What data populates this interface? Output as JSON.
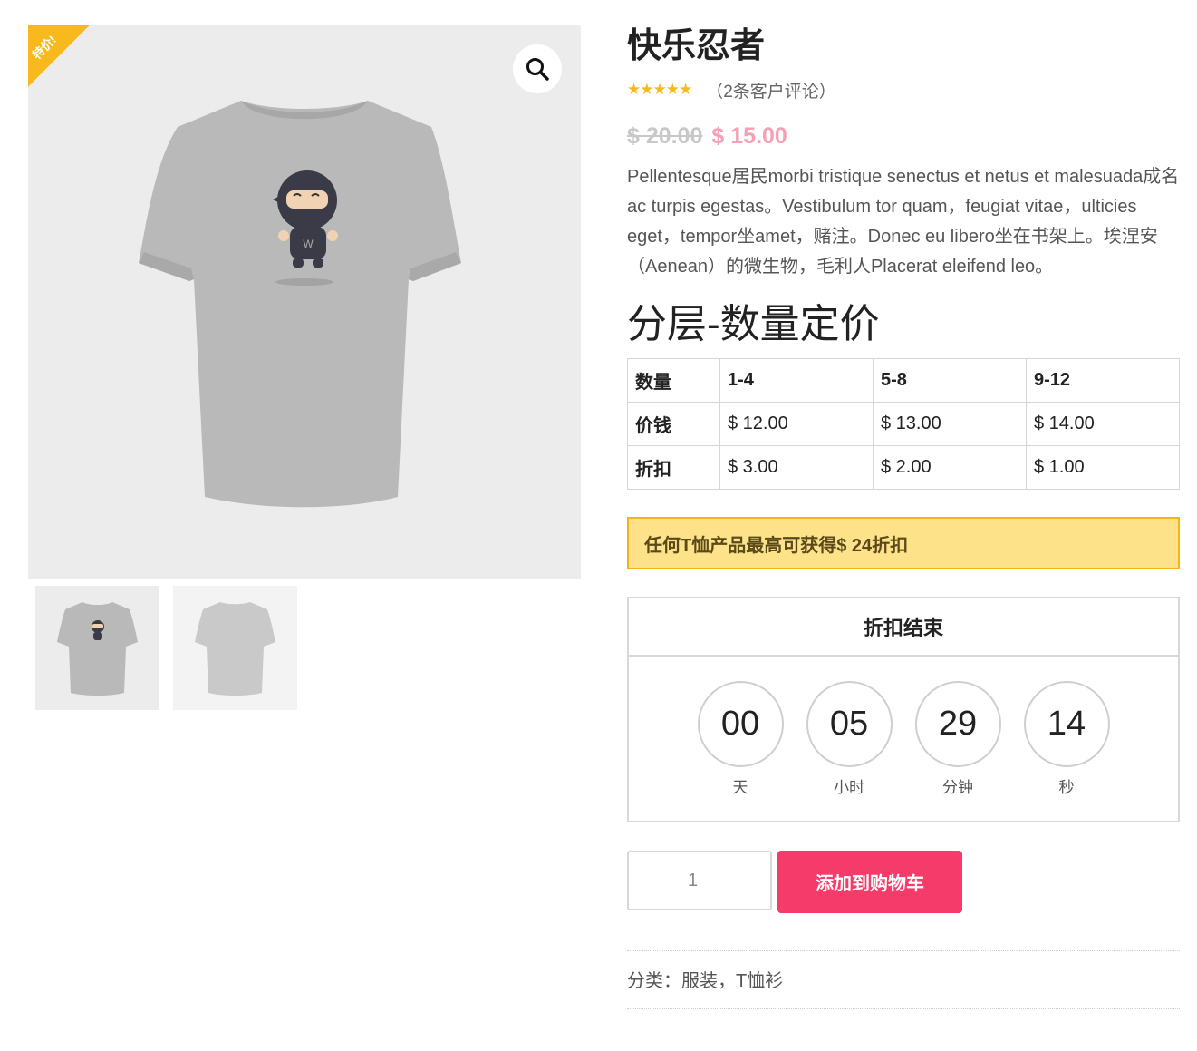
{
  "gallery": {
    "sale_badge": "特价!",
    "zoom_icon": "magnifier-icon",
    "thumbnails": [
      "tshirt-front-thumbnail",
      "tshirt-back-thumbnail"
    ]
  },
  "product": {
    "title": "快乐忍者",
    "rating_stars": "★★★★★",
    "rating_value": 5,
    "reviews_text": "（2条客户评论）",
    "old_price": "$ 20.00",
    "new_price": "$ 15.00",
    "description": "Pellentesque居民morbi tristique senectus et netus et malesuada成名ac turpis egestas。Vestibulum tor quam，feugiat vitae，ulticies eget，tempor坐amet，赌注。Donec eu libero坐在书架上。埃涅安（Aenean）的微生物，毛利人Placerat eleifend leo。"
  },
  "tiers": {
    "heading": "分层-数量定价",
    "rows": [
      [
        "数量",
        "1-4",
        "5-8",
        "9-12"
      ],
      [
        "价钱",
        "$  12.00",
        "$  13.00",
        "$  14.00"
      ],
      [
        "折扣",
        "$  3.00",
        "$  2.00",
        "$  1.00"
      ]
    ]
  },
  "promo": {
    "text": "任何T恤产品最高可获得$ 24折扣"
  },
  "countdown": {
    "title": "折扣结束",
    "units": [
      {
        "value": "00",
        "label": "天"
      },
      {
        "value": "05",
        "label": "小时"
      },
      {
        "value": "29",
        "label": "分钟"
      },
      {
        "value": "14",
        "label": "秒"
      }
    ]
  },
  "cart": {
    "quantity": "1",
    "add_label": "添加到购物车"
  },
  "meta": {
    "category_label": "分类：",
    "categories": [
      "服装",
      "T恤衫"
    ],
    "separator": "，"
  },
  "colors": {
    "sale_badge": "#f7b91b",
    "new_price": "#f6a0b5",
    "add_to_cart": "#f53b6a",
    "promo_bg": "#fee28a",
    "promo_border": "#f2b517"
  }
}
